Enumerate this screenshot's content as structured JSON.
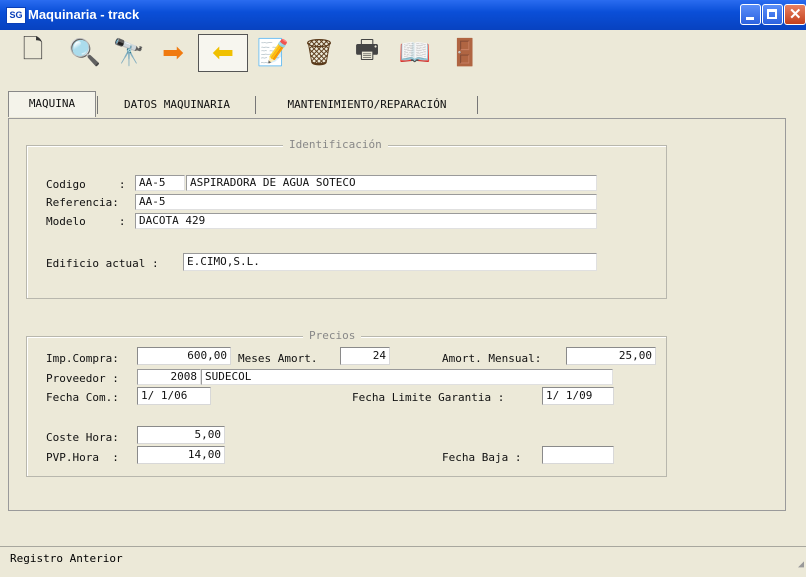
{
  "window": {
    "title": "Maquinaria - track",
    "app_icon_text": "SG"
  },
  "toolbar": {
    "items": [
      {
        "name": "new-document-icon",
        "glyph": "🗋"
      },
      {
        "name": "search-icon",
        "glyph": "🔍"
      },
      {
        "name": "binoculars-icon",
        "glyph": "🔭"
      },
      {
        "name": "next-record-arrow-icon",
        "glyph": "➡"
      },
      {
        "name": "previous-record-arrow-icon",
        "glyph": "⬅"
      },
      {
        "name": "edit-document-icon",
        "glyph": "📝"
      },
      {
        "name": "delete-basket-icon",
        "glyph": "🗑"
      },
      {
        "name": "print-icon",
        "glyph": "🖶"
      },
      {
        "name": "help-book-icon",
        "glyph": "📖"
      },
      {
        "name": "exit-door-icon",
        "glyph": "🚪"
      }
    ]
  },
  "tabs": [
    "MAQUINA",
    "DATOS MAQUINARIA",
    "MANTENIMIENTO/REPARACIÓN"
  ],
  "identificacion": {
    "legend": "Identificación",
    "codigo_label": "Codigo     :",
    "codigo_value": "AA-5",
    "descripcion_value": "ASPIRADORA DE AGUA SOTECO",
    "referencia_label": "Referencia:",
    "referencia_value": "AA-5",
    "modelo_label": "Modelo     :",
    "modelo_value": "DACOTA 429",
    "edificio_label": "Edificio actual :",
    "edificio_value": "E.CIMO,S.L."
  },
  "precios": {
    "legend": "Precios",
    "imp_compra_label": "Imp.Compra:",
    "imp_compra_value": "600,00",
    "meses_amort_label": "Meses Amort.",
    "meses_amort_value": "24",
    "amort_mensual_label": "Amort. Mensual:",
    "amort_mensual_value": "25,00",
    "proveedor_label": "Proveedor :",
    "proveedor_code": "2008",
    "proveedor_name": "SUDECOL",
    "fecha_com_label": "Fecha Com.:",
    "fecha_com_value": "1/ 1/06",
    "fecha_garantia_label": "Fecha Limite Garantia :",
    "fecha_garantia_value": "1/ 1/09",
    "coste_hora_label": "Coste Hora:",
    "coste_hora_value": "5,00",
    "pvp_hora_label": "PVP.Hora  :",
    "pvp_hora_value": "14,00",
    "fecha_baja_label": "Fecha Baja :",
    "fecha_baja_value": ""
  },
  "status": {
    "text": "Registro Anterior"
  }
}
